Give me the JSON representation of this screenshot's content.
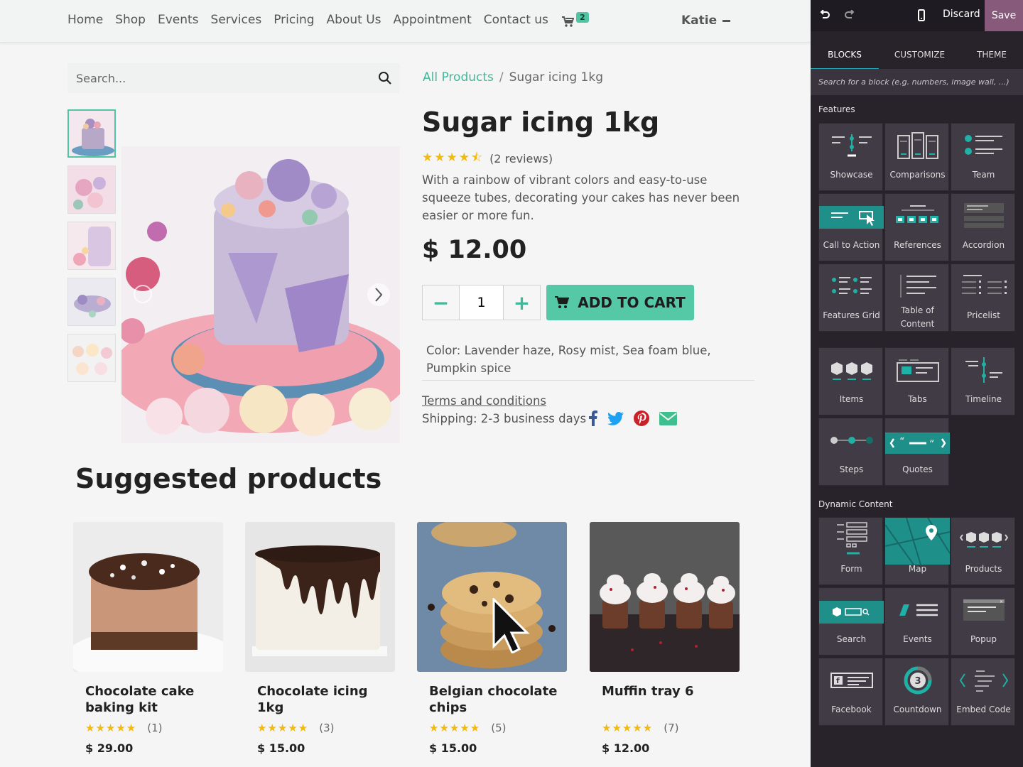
{
  "nav": {
    "items": [
      "Home",
      "Shop",
      "Events",
      "Services",
      "Pricing",
      "About Us",
      "Appointment",
      "Contact us"
    ],
    "cart_count": "2",
    "user": "Katie"
  },
  "search": {
    "placeholder": "Search..."
  },
  "breadcrumb": {
    "root": "All Products",
    "sep": "/",
    "current": "Sugar icing 1kg"
  },
  "product": {
    "title": "Sugar icing 1kg",
    "stars": "★★★★⯪",
    "reviews": "(2 reviews)",
    "description": "With a rainbow of vibrant colors and easy-to-use squeeze tubes, decorating your cakes has never been easier or more fun.",
    "price": "$ 12.00",
    "qty_minus": "−",
    "qty": "1",
    "qty_plus": "+",
    "add_to_cart": "ADD TO CART",
    "color": "Color: Lavender haze, Rosy mist, Sea foam blue, Pumpkin spice",
    "terms": "Terms and conditions",
    "shipping": "Shipping: 2-3 business days"
  },
  "suggested": {
    "title": "Suggested products",
    "items": [
      {
        "name": "Chocolate cake baking kit",
        "stars": "★★★★★",
        "count": "(1)",
        "price": "$ 29.00"
      },
      {
        "name": "Chocolate icing 1kg",
        "stars": "★★★★★",
        "count": "(3)",
        "price": "$ 15.00"
      },
      {
        "name": "Belgian chocolate chips",
        "stars": "★★★★★",
        "count": "(5)",
        "price": "$ 15.00"
      },
      {
        "name": "Muffin tray 6",
        "stars": "★★★★★",
        "count": "(7)",
        "price": "$ 12.00"
      }
    ]
  },
  "editor": {
    "discard": "Discard",
    "save": "Save",
    "tabs": [
      "BLOCKS",
      "CUSTOMIZE",
      "THEME"
    ],
    "search_placeholder": "Search for a block (e.g. numbers, image wall, ...)",
    "features_title": "Features",
    "features": [
      "Showcase",
      "Comparisons",
      "Team",
      "Call to Action",
      "References",
      "Accordion",
      "Features Grid",
      "Table of Content",
      "Pricelist",
      "Items",
      "Tabs",
      "Timeline",
      "Steps",
      "Quotes"
    ],
    "dynamic_title": "Dynamic Content",
    "dynamic": [
      "Form",
      "Map",
      "Products",
      "Search",
      "Events",
      "Popup",
      "Facebook",
      "Countdown",
      "Embed Code"
    ]
  },
  "colors": {
    "accent": "#4fc6a1",
    "editor_bg": "#28232b",
    "save": "#875a7b",
    "star": "#f2b90f"
  }
}
